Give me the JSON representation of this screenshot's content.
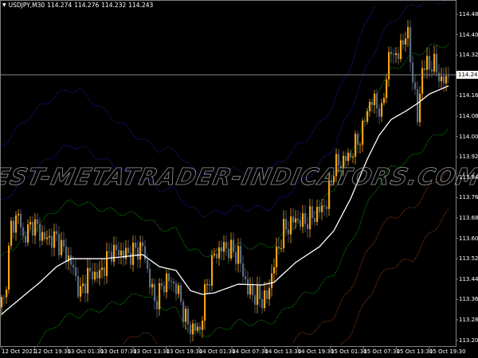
{
  "header": {
    "symbol": "USDJPY,M30",
    "open": "114.274",
    "high": "114.276",
    "low": "114.232",
    "close": "114.243"
  },
  "current_price": "114.243",
  "watermark": "BEST-METATRADER-INDICATORS.COM",
  "colors": {
    "background": "#000000",
    "bull": "#f5a30f",
    "bear": "#5a6b80",
    "ma": "#ffffff",
    "band1": "#0a8a0a",
    "upper_band": "#1a1a9a",
    "lower_band": "#8a3a14",
    "grid": "#808080"
  },
  "chart_data": {
    "type": "candlestick",
    "symbol": "USDJPY",
    "timeframe": "M30",
    "ylim": [
      113.18,
      114.536
    ],
    "y_ticks": [
      "114.480",
      "114.400",
      "114.320",
      "114.160",
      "114.080",
      "114.000",
      "113.920",
      "113.840",
      "113.760",
      "113.680",
      "113.600",
      "113.520",
      "113.440",
      "113.360",
      "113.280",
      "113.200"
    ],
    "x_ticks": [
      "12 Oct 2021",
      "12 Oct 19:30",
      "13 Oct 01:30",
      "13 Oct 07:30",
      "13 Oct 13:30",
      "13 Oct 19:30",
      "14 Oct 01:30",
      "14 Oct 07:30",
      "14 Oct 13:30",
      "14 Oct 19:30",
      "15 Oct 01:30",
      "15 Oct 07:30",
      "15 Oct 13:30",
      "15 Oct 19:30"
    ],
    "bars": 188,
    "close_path": [
      [
        1,
        113.349
      ],
      [
        4,
        113.645
      ],
      [
        7,
        113.692
      ],
      [
        9,
        113.599
      ],
      [
        13,
        113.661
      ],
      [
        18,
        113.599
      ],
      [
        23,
        113.599
      ],
      [
        29,
        113.505
      ],
      [
        33,
        113.38
      ],
      [
        36,
        113.458
      ],
      [
        41,
        113.458
      ],
      [
        46,
        113.552
      ],
      [
        53,
        113.536
      ],
      [
        59,
        113.567
      ],
      [
        61,
        113.474
      ],
      [
        64,
        113.349
      ],
      [
        69,
        113.442
      ],
      [
        73,
        113.411
      ],
      [
        78,
        113.255
      ],
      [
        83,
        113.239
      ],
      [
        85,
        113.38
      ],
      [
        89,
        113.536
      ],
      [
        93,
        113.567
      ],
      [
        99,
        113.536
      ],
      [
        103,
        113.395
      ],
      [
        108,
        113.364
      ],
      [
        111,
        113.364
      ],
      [
        114,
        113.505
      ],
      [
        118,
        113.63
      ],
      [
        123,
        113.677
      ],
      [
        126,
        113.661
      ],
      [
        131,
        113.692
      ],
      [
        136,
        113.739
      ],
      [
        139,
        113.88
      ],
      [
        146,
        113.927
      ],
      [
        151,
        114.02
      ],
      [
        153,
        114.114
      ],
      [
        156,
        114.145
      ],
      [
        159,
        114.083
      ],
      [
        161,
        114.255
      ],
      [
        163,
        114.333
      ],
      [
        166,
        114.317
      ],
      [
        169,
        114.411
      ],
      [
        170,
        114.38
      ],
      [
        172,
        114.239
      ],
      [
        174,
        114.067
      ],
      [
        176,
        114.27
      ],
      [
        179,
        114.286
      ],
      [
        182,
        114.27
      ],
      [
        184,
        114.208
      ],
      [
        187,
        114.243
      ]
    ],
    "moving_average": [
      [
        0,
        113.302
      ],
      [
        6,
        113.349
      ],
      [
        16,
        113.427
      ],
      [
        23,
        113.489
      ],
      [
        29,
        113.52
      ],
      [
        43,
        113.52
      ],
      [
        59,
        113.536
      ],
      [
        66,
        113.489
      ],
      [
        73,
        113.474
      ],
      [
        79,
        113.395
      ],
      [
        84,
        113.38
      ],
      [
        89,
        113.386
      ],
      [
        99,
        113.42
      ],
      [
        109,
        113.417
      ],
      [
        114,
        113.427
      ],
      [
        123,
        113.505
      ],
      [
        133,
        113.567
      ],
      [
        139,
        113.63
      ],
      [
        146,
        113.755
      ],
      [
        153,
        113.911
      ],
      [
        158,
        114.005
      ],
      [
        163,
        114.067
      ],
      [
        169,
        114.099
      ],
      [
        174,
        114.13
      ],
      [
        179,
        114.167
      ],
      [
        187,
        114.199
      ]
    ],
    "band_deviation": [
      [
        0,
        0.22
      ],
      [
        13,
        0.23
      ],
      [
        33,
        0.22
      ],
      [
        59,
        0.15
      ],
      [
        80,
        0.16
      ],
      [
        99,
        0.15
      ],
      [
        125,
        0.15
      ],
      [
        150,
        0.18
      ],
      [
        172,
        0.2
      ],
      [
        187,
        0.165
      ]
    ],
    "band_multipliers": [
      1,
      2,
      3
    ]
  }
}
